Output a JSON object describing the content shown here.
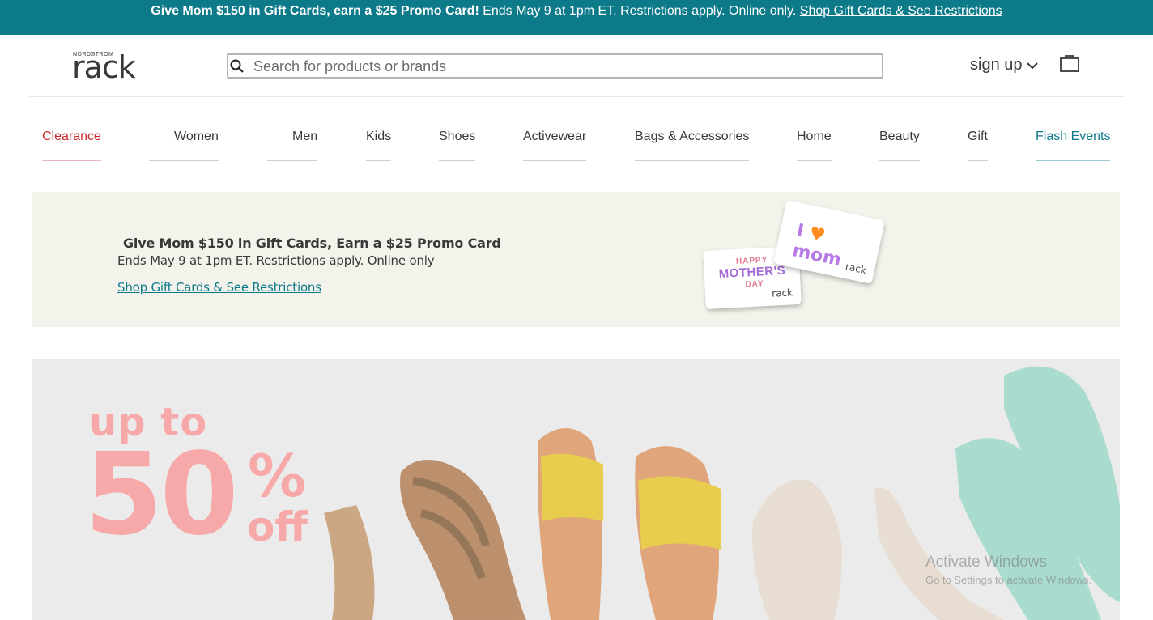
{
  "topbar": {
    "bold": "Give Mom $150 in Gift Cards, earn a $25 Promo Card!",
    "text": " Ends May 9 at 1pm ET. Restrictions apply. Online only. ",
    "link": "Shop Gift Cards & See Restrictions"
  },
  "header": {
    "logo_small": "NORDSTROM",
    "logo_big": "rack",
    "search_placeholder": "Search for products or brands",
    "signup": "sign up"
  },
  "nav": {
    "items": [
      "Clearance",
      "Women",
      "Men",
      "Kids",
      "Shoes",
      "Activewear",
      "Bags & Accessories",
      "Home",
      "Beauty",
      "Gift",
      "Flash Events"
    ]
  },
  "promo": {
    "headline": "Give Mom $150 in Gift Cards, Earn a $25 Promo Card",
    "subtext": "Ends May 9 at 1pm ET. Restrictions apply. Online only",
    "link": "Shop Gift Cards & See Restrictions",
    "card1_line1": "HAPPY",
    "card1_line2": "MOTHER'S",
    "card1_line3": "DAY",
    "card1_brand": "rack",
    "card2_i": "I",
    "card2_heart": "♥",
    "card2_mom": "mom",
    "card2_brand": "rack"
  },
  "hero": {
    "upto": "up to",
    "percent": "50",
    "pct_sign": "%",
    "off": "off"
  },
  "watermark": {
    "title": "Activate Windows",
    "sub": "Go to Settings to activate Windows."
  },
  "colors": {
    "topbar": "#0d7a8a",
    "clearance": "#c9282d",
    "flash": "#0d7a8a",
    "hero_text": "#f7a9a9"
  }
}
